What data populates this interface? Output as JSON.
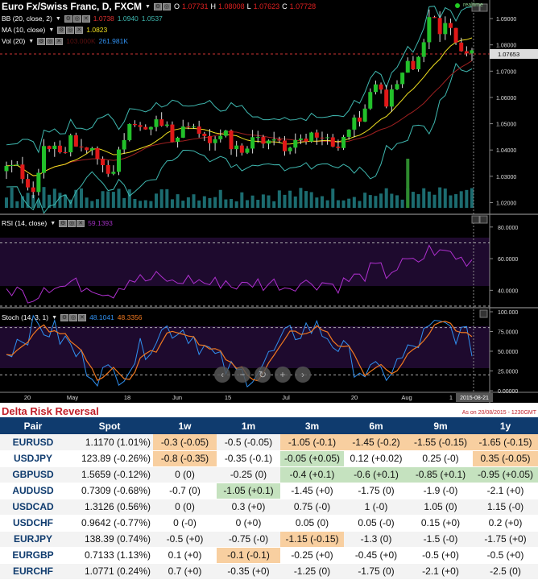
{
  "chart": {
    "title": "Euro Fx/Swiss Franc, D, FXCM",
    "ohlc": {
      "o_label": "O",
      "o": "1.07731",
      "h_label": "H",
      "h": "1.08008",
      "l_label": "L",
      "l": "1.07623",
      "c_label": "C",
      "c": "1.07728"
    },
    "realtime_label": "realtime",
    "bb": {
      "label": "BB (20, close, 2)",
      "v1": "1.0738",
      "v2": "1.0940",
      "v3": "1.0537"
    },
    "ma": {
      "label": "MA (10, close)",
      "value": "1.0823"
    },
    "vol": {
      "label": "Vol (20)",
      "v1": "103.000K",
      "v2": "261.981K"
    },
    "price_axis": [
      "1.09000",
      "1.08000",
      "1.07000",
      "1.06000",
      "1.05000",
      "1.04000",
      "1.03000",
      "1.02000"
    ],
    "current_price": "1.07653",
    "rsi": {
      "label": "RSI (14, close)",
      "value": "59.1393",
      "axis": [
        "80.0000",
        "60.0000",
        "40.0000"
      ]
    },
    "stoch": {
      "label": "Stoch (14, 3, 1)",
      "k": "48.1041",
      "d": "48.3356",
      "axis": [
        "100.000",
        "75.0000",
        "50.0000",
        "25.0000",
        "0.00000"
      ]
    },
    "x_axis": [
      "20",
      "May",
      "18",
      "Jun",
      "15",
      "Jul",
      "20",
      "Aug",
      "1"
    ],
    "cursor_date": "2015-08-21",
    "colors": {
      "up": "#22c02a",
      "down": "#e01818",
      "bb": "#3fb8b0",
      "ma": "#f0e020",
      "rsi": "#b030d0",
      "stoch_k": "#3090f0",
      "stoch_d": "#f07820"
    }
  },
  "drr": {
    "title": "Delta Risk Reversal",
    "as_of": "As on 20/08/2015 - 1230GMT",
    "headers": [
      "Pair",
      "Spot",
      "1w",
      "1m",
      "3m",
      "6m",
      "9m",
      "1y"
    ],
    "rows": [
      {
        "pair": "EURUSD",
        "spot": "1.1170 (1.01%)",
        "c": [
          "-0.3 (-0.05)",
          "-0.5 (-0.05)",
          "-1.05 (-0.1)",
          "-1.45 (-0.2)",
          "-1.55 (-0.15)",
          "-1.65 (-0.15)"
        ],
        "hl": [
          "orange",
          "",
          "orange",
          "orange",
          "orange",
          "orange"
        ]
      },
      {
        "pair": "USDJPY",
        "spot": "123.89 (-0.26%)",
        "c": [
          "-0.8 (-0.35)",
          "-0.35 (-0.1)",
          "-0.05 (+0.05)",
          "0.12 (+0.02)",
          "0.25 (-0)",
          "0.35 (-0.05)"
        ],
        "hl": [
          "orange",
          "",
          "green",
          "",
          "",
          "orange"
        ]
      },
      {
        "pair": "GBPUSD",
        "spot": "1.5659 (-0.12%)",
        "c": [
          "0 (0)",
          "-0.25 (0)",
          "-0.4 (+0.1)",
          "-0.6 (+0.1)",
          "-0.85 (+0.1)",
          "-0.95 (+0.05)"
        ],
        "hl": [
          "",
          "",
          "green",
          "green",
          "green",
          "green"
        ]
      },
      {
        "pair": "AUDUSD",
        "spot": "0.7309 (-0.68%)",
        "c": [
          "-0.7 (0)",
          "-1.05 (+0.1)",
          "-1.45 (+0)",
          "-1.75 (0)",
          "-1.9 (-0)",
          "-2.1 (+0)"
        ],
        "hl": [
          "",
          "green",
          "",
          "",
          "",
          ""
        ]
      },
      {
        "pair": "USDCAD",
        "spot": "1.3126 (0.56%)",
        "c": [
          "0 (0)",
          "0.3 (+0)",
          "0.75 (-0)",
          "1 (-0)",
          "1.05 (0)",
          "1.15 (-0)"
        ],
        "hl": [
          "",
          "",
          "",
          "",
          "",
          ""
        ]
      },
      {
        "pair": "USDCHF",
        "spot": "0.9642 (-0.77%)",
        "c": [
          "0 (-0)",
          "0 (+0)",
          "0.05 (0)",
          "0.05 (-0)",
          "0.15 (+0)",
          "0.2 (+0)"
        ],
        "hl": [
          "",
          "",
          "",
          "",
          "",
          ""
        ]
      },
      {
        "pair": "EURJPY",
        "spot": "138.39 (0.74%)",
        "c": [
          "-0.5 (+0)",
          "-0.75 (-0)",
          "-1.15 (-0.15)",
          "-1.3 (0)",
          "-1.5 (-0)",
          "-1.75 (+0)"
        ],
        "hl": [
          "",
          "",
          "orange",
          "",
          "",
          ""
        ]
      },
      {
        "pair": "EURGBP",
        "spot": "0.7133 (1.13%)",
        "c": [
          "0.1 (+0)",
          "-0.1 (-0.1)",
          "-0.25 (+0)",
          "-0.45 (+0)",
          "-0.5 (+0)",
          "-0.5 (+0)"
        ],
        "hl": [
          "",
          "orange",
          "",
          "",
          "",
          ""
        ]
      },
      {
        "pair": "EURCHF",
        "spot": "1.0771 (0.24%)",
        "c": [
          "0.7 (+0)",
          "-0.35 (+0)",
          "-1.25 (0)",
          "-1.75 (0)",
          "-2.1 (+0)",
          "-2.5 (0)"
        ],
        "hl": [
          "",
          "",
          "",
          "",
          "",
          ""
        ]
      }
    ]
  }
}
